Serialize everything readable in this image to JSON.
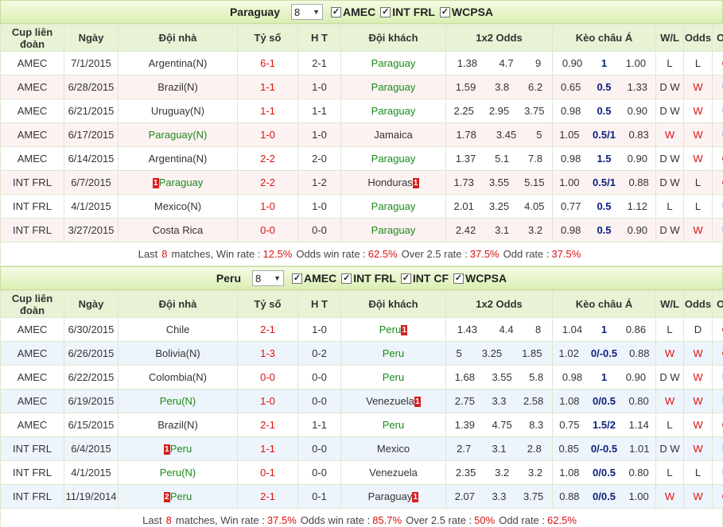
{
  "headers": {
    "cup": "Cup liên đoàn",
    "date": "Ngày",
    "home": "Đội nhà",
    "score": "Tỷ số",
    "ht": "H T",
    "away": "Đội khách",
    "odds_1x2": "1x2 Odds",
    "asian": "Kèo châu Á",
    "wl": "W/L",
    "odds": "Odds",
    "ou": "O/U"
  },
  "sections": [
    {
      "team": "Paraguay",
      "count": "8",
      "filters": [
        "AMEC",
        "INT FRL",
        "WCPSA"
      ],
      "rows": [
        {
          "cup": "AMEC",
          "date": "7/1/2015",
          "home": "Argentina(N)",
          "home_green": false,
          "home_badge": "",
          "score": "6-1",
          "ht": "2-1",
          "away": "Paraguay",
          "away_green": true,
          "away_badge": "",
          "o1": "1.38",
          "ox": "4.7",
          "o2": "9",
          "ah1": "0.90",
          "ahl": "1",
          "ah2": "1.00",
          "wl": "L",
          "wl_red": false,
          "odds": "L",
          "odds_red": false,
          "ou": "O"
        },
        {
          "cup": "AMEC",
          "date": "6/28/2015",
          "home": "Brazil(N)",
          "home_green": false,
          "home_badge": "",
          "score": "1-1",
          "ht": "1-0",
          "away": "Paraguay",
          "away_green": true,
          "away_badge": "",
          "o1": "1.59",
          "ox": "3.8",
          "o2": "6.2",
          "ah1": "0.65",
          "ahl": "0.5",
          "ah2": "1.33",
          "wl": "D W",
          "wl_red": false,
          "odds": "W",
          "odds_red": true,
          "ou": "U"
        },
        {
          "cup": "AMEC",
          "date": "6/21/2015",
          "home": "Uruguay(N)",
          "home_green": false,
          "home_badge": "",
          "score": "1-1",
          "ht": "1-1",
          "away": "Paraguay",
          "away_green": true,
          "away_badge": "",
          "o1": "2.25",
          "ox": "2.95",
          "o2": "3.75",
          "ah1": "0.98",
          "ahl": "0.5",
          "ah2": "0.90",
          "wl": "D W",
          "wl_red": false,
          "odds": "W",
          "odds_red": true,
          "ou": "U"
        },
        {
          "cup": "AMEC",
          "date": "6/17/2015",
          "home": "Paraguay(N)",
          "home_green": true,
          "home_badge": "",
          "score": "1-0",
          "ht": "1-0",
          "away": "Jamaica",
          "away_green": false,
          "away_badge": "",
          "o1": "1.78",
          "ox": "3.45",
          "o2": "5",
          "ah1": "1.05",
          "ahl": "0.5/1",
          "ah2": "0.83",
          "wl": "W",
          "wl_red": true,
          "odds": "W",
          "odds_red": true,
          "ou": "U"
        },
        {
          "cup": "AMEC",
          "date": "6/14/2015",
          "home": "Argentina(N)",
          "home_green": false,
          "home_badge": "",
          "score": "2-2",
          "ht": "2-0",
          "away": "Paraguay",
          "away_green": true,
          "away_badge": "",
          "o1": "1.37",
          "ox": "5.1",
          "o2": "7.8",
          "ah1": "0.98",
          "ahl": "1.5",
          "ah2": "0.90",
          "wl": "D W",
          "wl_red": false,
          "odds": "W",
          "odds_red": true,
          "ou": "O"
        },
        {
          "cup": "INT FRL",
          "date": "6/7/2015",
          "home": "Paraguay",
          "home_green": true,
          "home_badge": "1",
          "score": "2-2",
          "ht": "1-2",
          "away": "Honduras",
          "away_green": false,
          "away_badge": "1",
          "o1": "1.73",
          "ox": "3.55",
          "o2": "5.15",
          "ah1": "1.00",
          "ahl": "0.5/1",
          "ah2": "0.88",
          "wl": "D W",
          "wl_red": false,
          "odds": "L",
          "odds_red": false,
          "ou": "O"
        },
        {
          "cup": "INT FRL",
          "date": "4/1/2015",
          "home": "Mexico(N)",
          "home_green": false,
          "home_badge": "",
          "score": "1-0",
          "ht": "1-0",
          "away": "Paraguay",
          "away_green": true,
          "away_badge": "",
          "o1": "2.01",
          "ox": "3.25",
          "o2": "4.05",
          "ah1": "0.77",
          "ahl": "0.5",
          "ah2": "1.12",
          "wl": "L",
          "wl_red": false,
          "odds": "L",
          "odds_red": false,
          "ou": "U"
        },
        {
          "cup": "INT FRL",
          "date": "3/27/2015",
          "home": "Costa Rica",
          "home_green": false,
          "home_badge": "",
          "score": "0-0",
          "ht": "0-0",
          "away": "Paraguay",
          "away_green": true,
          "away_badge": "",
          "o1": "2.42",
          "ox": "3.1",
          "o2": "3.2",
          "ah1": "0.98",
          "ahl": "0.5",
          "ah2": "0.90",
          "wl": "D W",
          "wl_red": false,
          "odds": "W",
          "odds_red": true,
          "ou": "U"
        }
      ],
      "summary": {
        "prefix": "Last",
        "count": "8",
        "matches_label": "matches, Win rate :",
        "win_rate": "12.5%",
        "odds_label": "Odds win rate :",
        "odds_rate": "62.5%",
        "over_label": "Over 2.5 rate :",
        "over_rate": "37.5%",
        "odd_label": "Odd rate :",
        "odd_rate": "37.5%"
      }
    },
    {
      "team": "Peru",
      "count": "8",
      "filters": [
        "AMEC",
        "INT FRL",
        "INT CF",
        "WCPSA"
      ],
      "rows": [
        {
          "cup": "AMEC",
          "date": "6/30/2015",
          "home": "Chile",
          "home_green": false,
          "home_badge": "",
          "score": "2-1",
          "ht": "1-0",
          "away": "Peru",
          "away_green": true,
          "away_badge": "1",
          "o1": "1.43",
          "ox": "4.4",
          "o2": "8",
          "ah1": "1.04",
          "ahl": "1",
          "ah2": "0.86",
          "wl": "L",
          "wl_red": false,
          "odds": "D",
          "odds_red": false,
          "ou": "O"
        },
        {
          "cup": "AMEC",
          "date": "6/26/2015",
          "home": "Bolivia(N)",
          "home_green": false,
          "home_badge": "",
          "score": "1-3",
          "ht": "0-2",
          "away": "Peru",
          "away_green": true,
          "away_badge": "",
          "o1": "5",
          "ox": "3.25",
          "o2": "1.85",
          "ah1": "1.02",
          "ahl": "0/-0.5",
          "ah2": "0.88",
          "wl": "W",
          "wl_red": true,
          "odds": "W",
          "odds_red": true,
          "ou": "O"
        },
        {
          "cup": "AMEC",
          "date": "6/22/2015",
          "home": "Colombia(N)",
          "home_green": false,
          "home_badge": "",
          "score": "0-0",
          "ht": "0-0",
          "away": "Peru",
          "away_green": true,
          "away_badge": "",
          "o1": "1.68",
          "ox": "3.55",
          "o2": "5.8",
          "ah1": "0.98",
          "ahl": "1",
          "ah2": "0.90",
          "wl": "D W",
          "wl_red": false,
          "odds": "W",
          "odds_red": true,
          "ou": "U"
        },
        {
          "cup": "AMEC",
          "date": "6/19/2015",
          "home": "Peru(N)",
          "home_green": true,
          "home_badge": "",
          "score": "1-0",
          "ht": "0-0",
          "away": "Venezuela",
          "away_green": false,
          "away_badge": "1",
          "o1": "2.75",
          "ox": "3.3",
          "o2": "2.58",
          "ah1": "1.08",
          "ahl": "0/0.5",
          "ah2": "0.80",
          "wl": "W",
          "wl_red": true,
          "odds": "W",
          "odds_red": true,
          "ou": "U"
        },
        {
          "cup": "AMEC",
          "date": "6/15/2015",
          "home": "Brazil(N)",
          "home_green": false,
          "home_badge": "",
          "score": "2-1",
          "ht": "1-1",
          "away": "Peru",
          "away_green": true,
          "away_badge": "",
          "o1": "1.39",
          "ox": "4.75",
          "o2": "8.3",
          "ah1": "0.75",
          "ahl": "1.5/2",
          "ah2": "1.14",
          "wl": "L",
          "wl_red": false,
          "odds": "W",
          "odds_red": true,
          "ou": "O"
        },
        {
          "cup": "INT FRL",
          "date": "6/4/2015",
          "home": "Peru",
          "home_green": true,
          "home_badge": "1",
          "score": "1-1",
          "ht": "0-0",
          "away": "Mexico",
          "away_green": false,
          "away_badge": "",
          "o1": "2.7",
          "ox": "3.1",
          "o2": "2.8",
          "ah1": "0.85",
          "ahl": "0/-0.5",
          "ah2": "1.01",
          "wl": "D W",
          "wl_red": false,
          "odds": "W",
          "odds_red": true,
          "ou": "U"
        },
        {
          "cup": "INT FRL",
          "date": "4/1/2015",
          "home": "Peru(N)",
          "home_green": true,
          "home_badge": "",
          "score": "0-1",
          "ht": "0-0",
          "away": "Venezuela",
          "away_green": false,
          "away_badge": "",
          "o1": "2.35",
          "ox": "3.2",
          "o2": "3.2",
          "ah1": "1.08",
          "ahl": "0/0.5",
          "ah2": "0.80",
          "wl": "L",
          "wl_red": false,
          "odds": "L",
          "odds_red": false,
          "ou": "U"
        },
        {
          "cup": "INT FRL",
          "date": "11/19/2014",
          "home": "Peru",
          "home_green": true,
          "home_badge": "2",
          "score": "2-1",
          "ht": "0-1",
          "away": "Paraguay",
          "away_green": false,
          "away_badge": "1",
          "o1": "2.07",
          "ox": "3.3",
          "o2": "3.75",
          "ah1": "0.88",
          "ahl": "0/0.5",
          "ah2": "1.00",
          "wl": "W",
          "wl_red": true,
          "odds": "W",
          "odds_red": true,
          "ou": "O"
        }
      ],
      "summary": {
        "prefix": "Last",
        "count": "8",
        "matches_label": "matches, Win rate :",
        "win_rate": "37.5%",
        "odds_label": "Odds win rate :",
        "odds_rate": "85.7%",
        "over_label": "Over 2.5 rate :",
        "over_rate": "50%",
        "odd_label": "Odd rate :",
        "odd_rate": "62.5%"
      }
    }
  ],
  "icons": {
    "checkbox": "checkbox-checked-icon",
    "dropdown": "chevron-down-icon"
  },
  "colors": {
    "header_green": "#e8f3d5",
    "win_red": "#dd1111",
    "team_green": "#1a8a1a",
    "line_blue": "#0a1f7a"
  }
}
